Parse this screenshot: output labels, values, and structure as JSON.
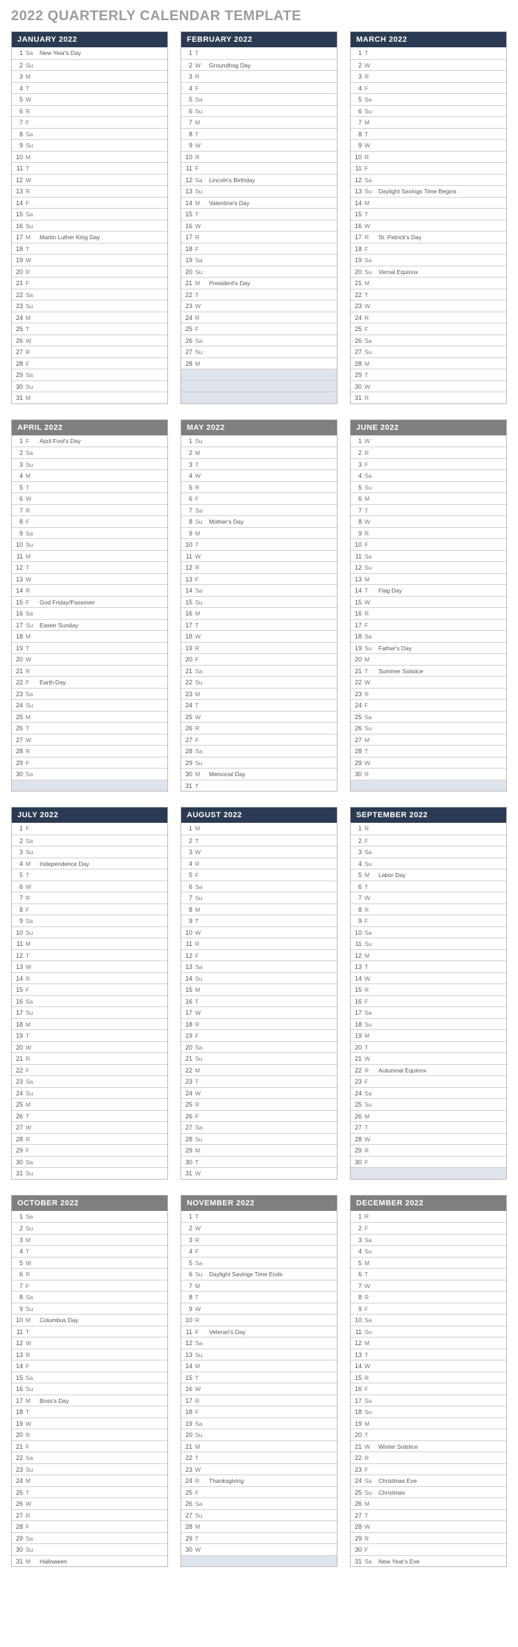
{
  "title": "2022 QUARTERLY CALENDAR TEMPLATE",
  "header_styles": [
    "dark",
    "gray",
    "dark",
    "gray"
  ],
  "quarters": [
    [
      {
        "name": "JANUARY 2022",
        "dow": [
          "Sa",
          "Su",
          "M",
          "T",
          "W",
          "R",
          "F",
          "Sa",
          "Su",
          "M",
          "T",
          "W",
          "R",
          "F",
          "Sa",
          "Su",
          "M",
          "T",
          "W",
          "R",
          "F",
          "Sa",
          "Su",
          "M",
          "T",
          "W",
          "R",
          "F",
          "Sa",
          "Su",
          "M"
        ],
        "pad": 0,
        "events": {
          "1": "New Year's Day",
          "17": "Martin Luther King Day"
        }
      },
      {
        "name": "FEBRUARY 2022",
        "dow": [
          "T",
          "W",
          "R",
          "F",
          "Sa",
          "Su",
          "M",
          "T",
          "W",
          "R",
          "F",
          "Sa",
          "Su",
          "M",
          "T",
          "W",
          "R",
          "F",
          "Sa",
          "Su",
          "M",
          "T",
          "W",
          "R",
          "F",
          "Sa",
          "Su",
          "M"
        ],
        "pad": 3,
        "events": {
          "2": "Groundhog Day",
          "12": "Lincoln's Birthday",
          "14": "Valentine's Day",
          "21": "President's Day"
        }
      },
      {
        "name": "MARCH 2022",
        "dow": [
          "T",
          "W",
          "R",
          "F",
          "Sa",
          "Su",
          "M",
          "T",
          "W",
          "R",
          "F",
          "Sa",
          "Su",
          "M",
          "T",
          "W",
          "R",
          "F",
          "Sa",
          "Su",
          "M",
          "T",
          "W",
          "R",
          "F",
          "Sa",
          "Su",
          "M",
          "T",
          "W",
          "R"
        ],
        "pad": 0,
        "events": {
          "13": "Daylight Savings Time Begins",
          "17": "St. Patrick's Day",
          "20": "Vernal Equinox"
        }
      }
    ],
    [
      {
        "name": "APRIL 2022",
        "dow": [
          "F",
          "Sa",
          "Su",
          "M",
          "T",
          "W",
          "R",
          "F",
          "Sa",
          "Su",
          "M",
          "T",
          "W",
          "R",
          "F",
          "Sa",
          "Su",
          "M",
          "T",
          "W",
          "R",
          "F",
          "Sa",
          "Su",
          "M",
          "T",
          "W",
          "R",
          "F",
          "Sa"
        ],
        "pad": 1,
        "events": {
          "1": "April Fool's Day",
          "15": "God Friday/Passover",
          "17": "Easter Sunday",
          "22": "Earth Day"
        }
      },
      {
        "name": "MAY 2022",
        "dow": [
          "Su",
          "M",
          "T",
          "W",
          "R",
          "F",
          "Sa",
          "Su",
          "M",
          "T",
          "W",
          "R",
          "F",
          "Sa",
          "Su",
          "M",
          "T",
          "W",
          "R",
          "F",
          "Sa",
          "Su",
          "M",
          "T",
          "W",
          "R",
          "F",
          "Sa",
          "Su",
          "M",
          "T"
        ],
        "pad": 0,
        "events": {
          "8": "Mother's Day",
          "30": "Memorial Day"
        }
      },
      {
        "name": "JUNE 2022",
        "dow": [
          "W",
          "R",
          "F",
          "Sa",
          "Su",
          "M",
          "T",
          "W",
          "R",
          "F",
          "Sa",
          "Su",
          "M",
          "T",
          "W",
          "R",
          "F",
          "Sa",
          "Su",
          "M",
          "T",
          "W",
          "R",
          "F",
          "Sa",
          "Su",
          "M",
          "T",
          "W",
          "R"
        ],
        "pad": 1,
        "events": {
          "14": "Flag Day",
          "19": "Father's Day",
          "21": "Summer Solstice"
        }
      }
    ],
    [
      {
        "name": "JULY 2022",
        "dow": [
          "F",
          "Sa",
          "Su",
          "M",
          "T",
          "W",
          "R",
          "F",
          "Sa",
          "Su",
          "M",
          "T",
          "W",
          "R",
          "F",
          "Sa",
          "Su",
          "M",
          "T",
          "W",
          "R",
          "F",
          "Sa",
          "Su",
          "M",
          "T",
          "W",
          "R",
          "F",
          "Sa",
          "Su"
        ],
        "pad": 0,
        "events": {
          "4": "Independence Day"
        }
      },
      {
        "name": "AUGUST 2022",
        "dow": [
          "M",
          "T",
          "W",
          "R",
          "F",
          "Sa",
          "Su",
          "M",
          "T",
          "W",
          "R",
          "F",
          "Sa",
          "Su",
          "M",
          "T",
          "W",
          "R",
          "F",
          "Sa",
          "Su",
          "M",
          "T",
          "W",
          "R",
          "F",
          "Sa",
          "Su",
          "M",
          "T",
          "W"
        ],
        "pad": 0,
        "events": {}
      },
      {
        "name": "SEPTEMBER 2022",
        "dow": [
          "R",
          "F",
          "Sa",
          "Su",
          "M",
          "T",
          "W",
          "R",
          "F",
          "Sa",
          "Su",
          "M",
          "T",
          "W",
          "R",
          "F",
          "Sa",
          "Su",
          "M",
          "T",
          "W",
          "R",
          "F",
          "Sa",
          "Su",
          "M",
          "T",
          "W",
          "R",
          "F"
        ],
        "pad": 1,
        "events": {
          "5": "Labor Day",
          "22": "Autumnal Equinox"
        }
      }
    ],
    [
      {
        "name": "OCTOBER 2022",
        "dow": [
          "Sa",
          "Su",
          "M",
          "T",
          "W",
          "R",
          "F",
          "Sa",
          "Su",
          "M",
          "T",
          "W",
          "R",
          "F",
          "Sa",
          "Su",
          "M",
          "T",
          "W",
          "R",
          "F",
          "Sa",
          "Su",
          "M",
          "T",
          "W",
          "R",
          "F",
          "Sa",
          "Su",
          "M"
        ],
        "pad": 0,
        "events": {
          "10": "Columbus Day",
          "17": "Boss's Day",
          "31": "Halloween"
        }
      },
      {
        "name": "NOVEMBER 2022",
        "dow": [
          "T",
          "W",
          "R",
          "F",
          "Sa",
          "Su",
          "M",
          "T",
          "W",
          "R",
          "F",
          "Sa",
          "Su",
          "M",
          "T",
          "W",
          "R",
          "F",
          "Sa",
          "Su",
          "M",
          "T",
          "W",
          "R",
          "F",
          "Sa",
          "Su",
          "M",
          "T",
          "W"
        ],
        "pad": 1,
        "events": {
          "6": "Daylight Savings Time Ends",
          "11": "Veteran's Day",
          "24": "Thanksgiving"
        }
      },
      {
        "name": "DECEMBER 2022",
        "dow": [
          "R",
          "F",
          "Sa",
          "Su",
          "M",
          "T",
          "W",
          "R",
          "F",
          "Sa",
          "Su",
          "M",
          "T",
          "W",
          "R",
          "F",
          "Sa",
          "Su",
          "M",
          "T",
          "W",
          "R",
          "F",
          "Sa",
          "Su",
          "M",
          "T",
          "W",
          "R",
          "F",
          "Sa"
        ],
        "pad": 0,
        "events": {
          "21": "Winter Solstice",
          "24": "Christmas Eve",
          "25": "Christmas",
          "31": "New Year's Eve"
        }
      }
    ]
  ]
}
